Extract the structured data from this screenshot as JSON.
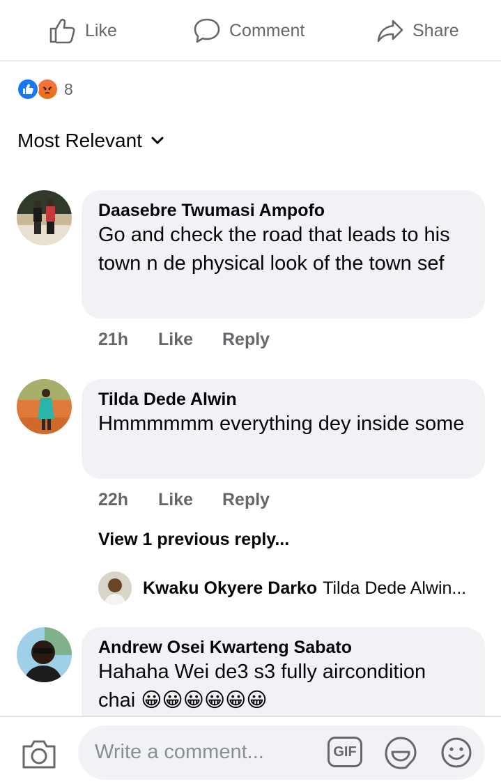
{
  "actions": {
    "like": "Like",
    "comment": "Comment",
    "share": "Share"
  },
  "reactions": {
    "count": "8"
  },
  "sort": {
    "label": "Most Relevant"
  },
  "comments": [
    {
      "author": "Daasebre Twumasi Ampofo",
      "text": "Go and check the road that leads to his town n de  physical look of the town sef",
      "time": "21h",
      "like": "Like",
      "reply": "Reply"
    },
    {
      "author": "Tilda Dede Alwin",
      "text": "Hmmmmmm everything dey inside some",
      "time": "22h",
      "like": "Like",
      "reply": "Reply",
      "view_previous": "View 1 previous reply...",
      "reply_preview": {
        "author": "Kwaku Okyere Darko",
        "text": "Tilda Dede Alwin..."
      }
    },
    {
      "author": "Andrew Osei Kwarteng Sabato",
      "text": "Hahaha Wei de3 s3 fully aircondition chai 😀😀😀😀😀😀"
    }
  ],
  "composer": {
    "placeholder": "Write a comment...",
    "gif": "GIF"
  }
}
